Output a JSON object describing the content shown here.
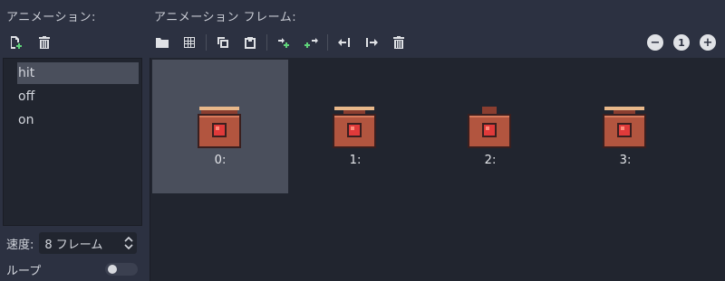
{
  "animations_panel": {
    "header": "アニメーション:",
    "new_icon": "new-animation-icon",
    "delete_icon": "delete-icon",
    "items": [
      {
        "label": "hit",
        "selected": true
      },
      {
        "label": "off",
        "selected": false
      },
      {
        "label": "on",
        "selected": false
      }
    ],
    "speed_label": "速度:",
    "speed_value": "8 フレーム",
    "loop_label": "ループ",
    "loop_enabled": false
  },
  "frames_panel": {
    "header": "アニメーション フレーム:",
    "toolbar_icons": [
      "load-folder-icon",
      "grid-icon",
      "copy-icon",
      "paste-icon",
      "insert-before-icon",
      "insert-after-icon",
      "move-left-icon",
      "move-right-icon",
      "delete-icon"
    ],
    "zoom": {
      "out": "−",
      "reset": "1",
      "in": "+"
    },
    "frames": [
      {
        "label": "0:",
        "selected": true
      },
      {
        "label": "1:",
        "selected": false
      },
      {
        "label": "2:",
        "selected": false
      },
      {
        "label": "3:",
        "selected": false
      }
    ]
  },
  "colors": {
    "background": "#2c3141",
    "panel_dark": "#21252f",
    "selection": "#4a4f5c",
    "add_green": "#5fd47a",
    "sprite_red": "#e03a3a",
    "sprite_brown": "#b2553f"
  }
}
